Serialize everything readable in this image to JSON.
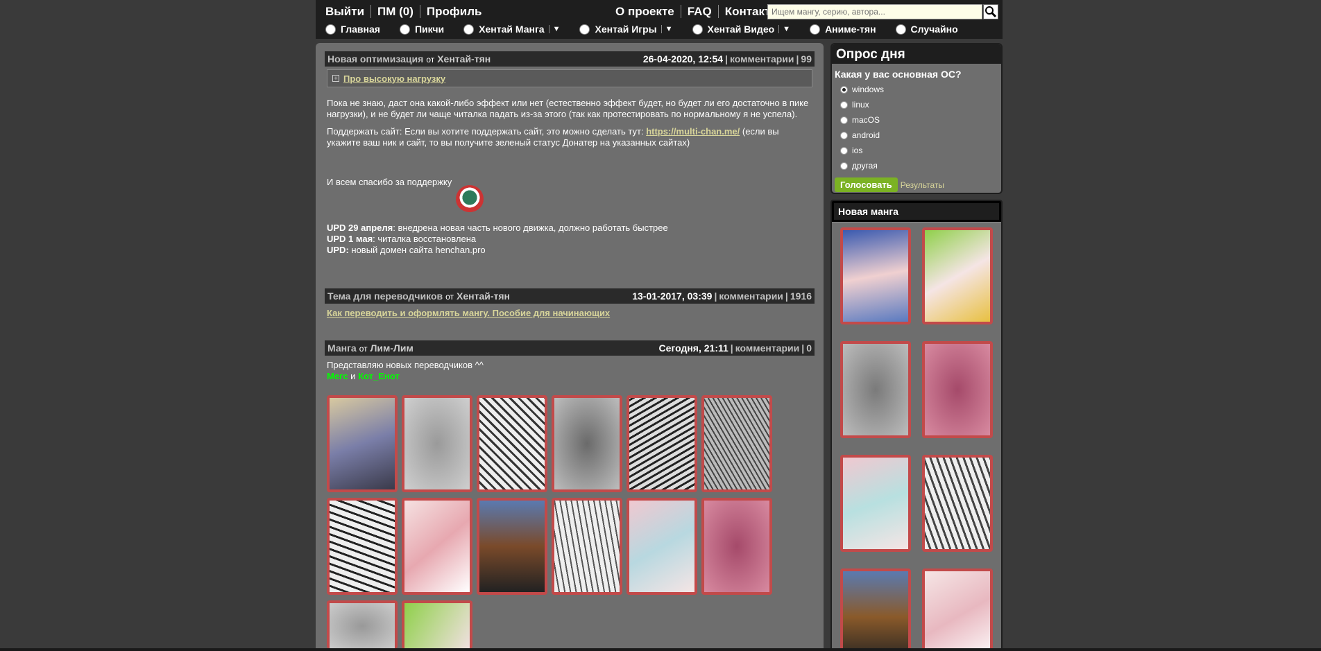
{
  "topbar": {
    "left_links": [
      "Выйти",
      "ПМ (0)",
      "Профиль"
    ],
    "right_links": [
      "О проекте",
      "FAQ",
      "Контакт"
    ],
    "search_placeholder": "Ищем мангу, серию, автора..."
  },
  "nav": [
    {
      "label": "Главная",
      "dropdown": false
    },
    {
      "label": "Пикчи",
      "dropdown": false
    },
    {
      "label": "Хентай Манга",
      "dropdown": true
    },
    {
      "label": "Хентай Игры",
      "dropdown": true
    },
    {
      "label": "Хентай Видео",
      "dropdown": true
    },
    {
      "label": "Аниме-тян",
      "dropdown": false
    },
    {
      "label": "Случайно",
      "dropdown": false
    }
  ],
  "posts": [
    {
      "title": "Новая оптимизация",
      "by": "от",
      "author": "Хентай-тян",
      "date": "26-04-2020, 12:54",
      "comments_label": "комментарии",
      "count": "99",
      "spoiler": "Про высокую нагрузку",
      "p1": "Пока не знаю, даст она какой-либо эффект или нет (естественно эффект будет, но будет ли его достаточно в пике нагрузки), и не будет ли чаще читалка падать из-за этого (так как протестировать по нормальному я не успела).",
      "p2a": "Поддержать сайт: Если вы хотите поддержать сайт, это можно сделать тут:",
      "p2link": "https://multi-chan.me/",
      "p2b": "(если вы укажите ваш ник и сайт, то вы получите зеленый статус Донатер на указанных сайтах)",
      "p3": "И всем спасибо за поддержку",
      "upd1b": "UPD 29 апреля",
      "upd1": ": внедрена новая часть нового движка, должно работать быстрее",
      "upd2b": "UPD 1 мая",
      "upd2": ": читалка восстановлена",
      "upd3b": "UPD:",
      "upd3": " новый домен сайта henchan.pro"
    },
    {
      "title": "Тема для переводчиков",
      "by": "от",
      "author": "Хентай-тян",
      "date": "13-01-2017, 03:39",
      "comments_label": "комментарии",
      "count": "1916",
      "link": "Как переводить и оформлять мангу. Пособие для начинающих"
    },
    {
      "title": "Манга",
      "by": "от",
      "author": "Лим-Лим",
      "date": "Сегодня, 21:11",
      "comments_label": "комментарии",
      "count": "0",
      "text": "Представляю новых переводчиков ^^",
      "name1": "Мегс",
      "and": "и",
      "name2": "Кот_Енот"
    }
  ],
  "poll": {
    "title": "Опрос дня",
    "question": "Какая у вас основная ОС?",
    "options": [
      "windows",
      "linux",
      "macOS",
      "android",
      "ios",
      "другая"
    ],
    "vote": "Голосовать",
    "results": "Результаты"
  },
  "new_manga": {
    "title": "Новая манга"
  },
  "colors": {
    "accent_link": "#d8d59a",
    "vote_green": "#7bb223",
    "thumb_border": "#c24a4a",
    "panel": "#6e6e6e",
    "bar": "#1e1e1e"
  }
}
